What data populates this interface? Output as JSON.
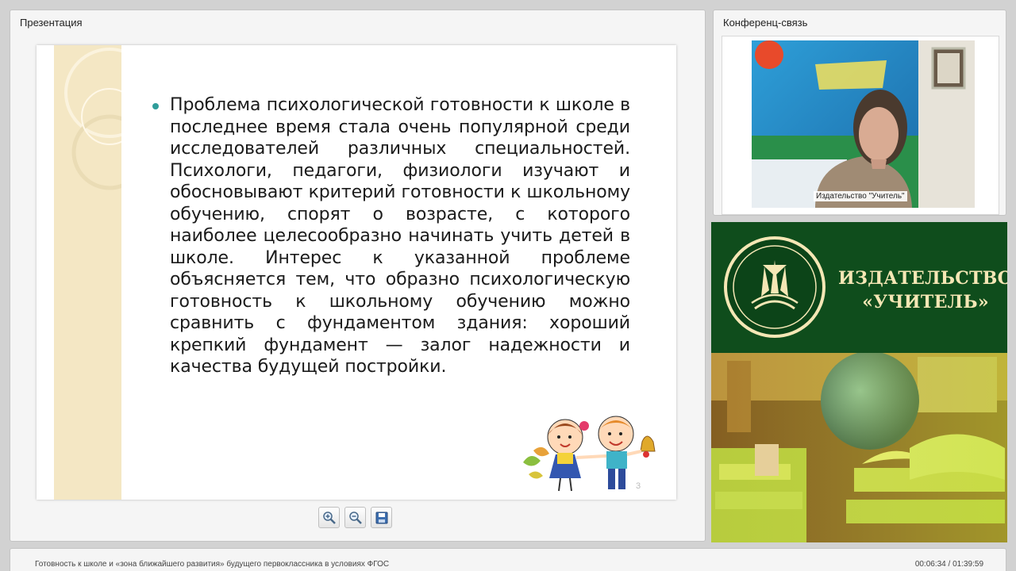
{
  "presentation": {
    "title": "Презентация",
    "slide_text": "Проблема психологической готовности к школе в последнее время стала очень популярной среди исследователей различных специальностей. Психологи, педагоги, физиологи изучают и обосновывают критерий готовности к школьному обучению, спорят о возрасте, с которого наиболее целесообразно начинать учить детей в школе. Интерес к указанной проблеме объясняется тем, что образно психологическую готовность к школьному обучению можно сравнить с фундаментом здания: хороший крепкий фундамент — залог надежности и качества будущей постройки.",
    "slide_number": "3",
    "toolbar": {
      "zoom_in_icon": "zoom-in-icon",
      "zoom_out_icon": "zoom-out-icon",
      "save_icon": "save-icon"
    }
  },
  "conference": {
    "title": "Конференц-связь",
    "video_label": "Издательство \"Учитель\""
  },
  "brand": {
    "line1": "ИЗДАТЕЛЬСТВО",
    "line2": "«УЧИТЕЛЬ»",
    "colors": {
      "green": "#0f4d1c",
      "gold": "#f5e7b5"
    }
  },
  "footer": {
    "title": "Готовность к школе и «зона ближайшего развития» будущего первоклассника в условиях ФГОС",
    "time": "00:06:34 / 01:39:59"
  }
}
